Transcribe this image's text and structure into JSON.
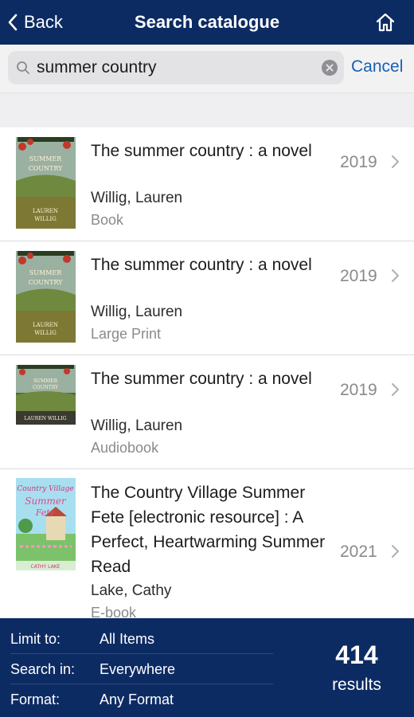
{
  "navbar": {
    "back_label": "Back",
    "title": "Search catalogue",
    "home_icon": "home-icon",
    "back_icon": "chevron-left-icon"
  },
  "search": {
    "value": "summer country",
    "icon": "search-icon",
    "clear_icon": "clear-icon",
    "cancel_label": "Cancel"
  },
  "results": [
    {
      "title": "The summer country : a novel",
      "author": "Willig, Lauren",
      "format": "Book",
      "year": "2019",
      "cover_text": [
        "THE",
        "SUMMER",
        "COUNTRY",
        "LAUREN",
        "WILLIG"
      ]
    },
    {
      "title": "The summer country : a novel",
      "author": "Willig, Lauren",
      "format": "Large Print",
      "year": "2019",
      "cover_text": [
        "THE",
        "SUMMER",
        "COUNTRY",
        "LAUREN",
        "WILLIG"
      ]
    },
    {
      "title": "The summer country : a novel",
      "author": "Willig, Lauren",
      "format": "Audiobook",
      "year": "2019",
      "cover_text": [
        "THE",
        "SUMMER",
        "COUNTRY",
        "LAUREN",
        "WILLIG"
      ]
    },
    {
      "title": "The Country Village Summer Fete [electronic resource] : A Perfect, Heartwarming Summer Read",
      "author": "Lake, Cathy",
      "format": "E-book",
      "year": "2021",
      "cover_text": [
        "The",
        "Country Village",
        "Summer",
        "Fete",
        "CATHY LAKE"
      ]
    }
  ],
  "footer": {
    "limit_label": "Limit to:",
    "limit_value": "All Items",
    "search_in_label": "Search in:",
    "search_in_value": "Everywhere",
    "format_label": "Format:",
    "format_value": "Any Format",
    "count": "414",
    "count_label": "results"
  },
  "colors": {
    "navy": "#0d2b63",
    "link_blue": "#1a5fb4",
    "secondary_text": "#8a8a8e"
  }
}
